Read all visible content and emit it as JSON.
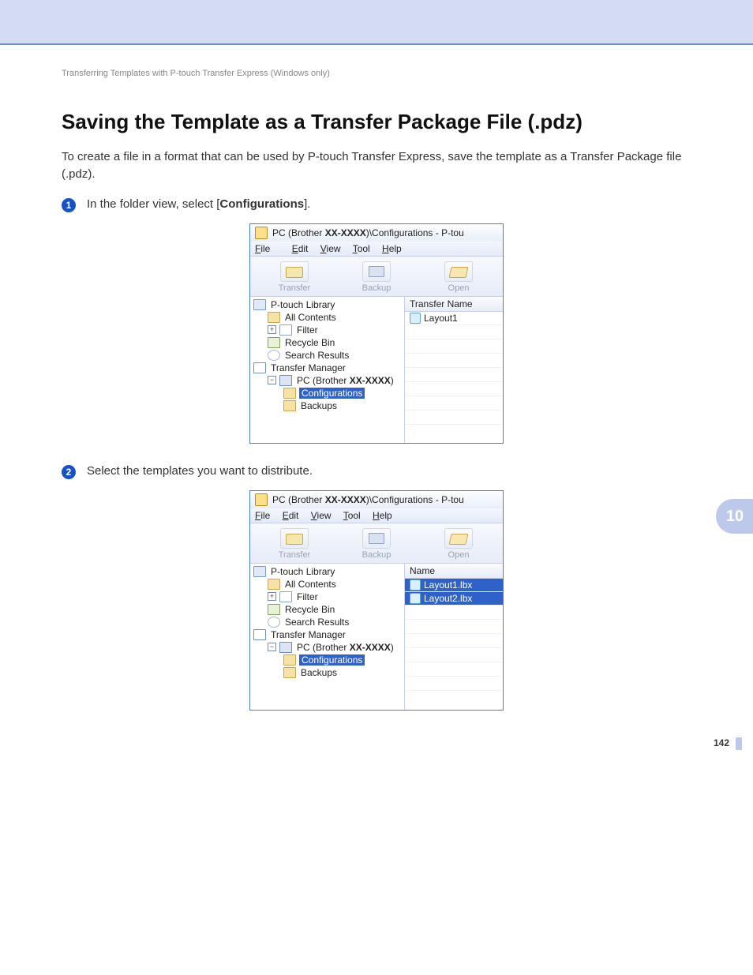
{
  "breadcrumb": "Transferring Templates with P-touch Transfer Express (Windows only)",
  "heading": "Saving the Template as a Transfer Package File (.pdz)",
  "intro": "To create a file in a format that can be used by P-touch Transfer Express, save the template as a Transfer Package file (.pdz).",
  "steps": {
    "s1_prefix": "In the folder view, select [",
    "s1_bold": "Configurations",
    "s1_suffix": "].",
    "s2": "Select the templates you want to distribute."
  },
  "chapter_number": "10",
  "page_number": "142",
  "win": {
    "title_prefix": "PC (Brother ",
    "title_bold": "XX-XXXX",
    "title_suffix": ")\\Configurations - P-tou",
    "menu": {
      "file": "File",
      "edit": "Edit",
      "view": "View",
      "tool": "Tool",
      "help": "Help"
    },
    "toolbar": {
      "transfer": "Transfer",
      "backup": "Backup",
      "open": "Open"
    },
    "tree": {
      "library": "P-touch Library",
      "all_contents": "All Contents",
      "filter": "Filter",
      "recycle": "Recycle Bin",
      "search": "Search Results",
      "manager": "Transfer Manager",
      "pc_prefix": "PC (Brother ",
      "pc_bold": "XX-XXXX",
      "pc_suffix": ")",
      "configurations": "Configurations",
      "backups": "Backups"
    }
  },
  "shot1": {
    "list_header": "Transfer Name",
    "items": [
      "Layout1"
    ]
  },
  "shot2": {
    "list_header": "Name",
    "items": [
      "Layout1.lbx",
      "Layout2.lbx"
    ]
  }
}
